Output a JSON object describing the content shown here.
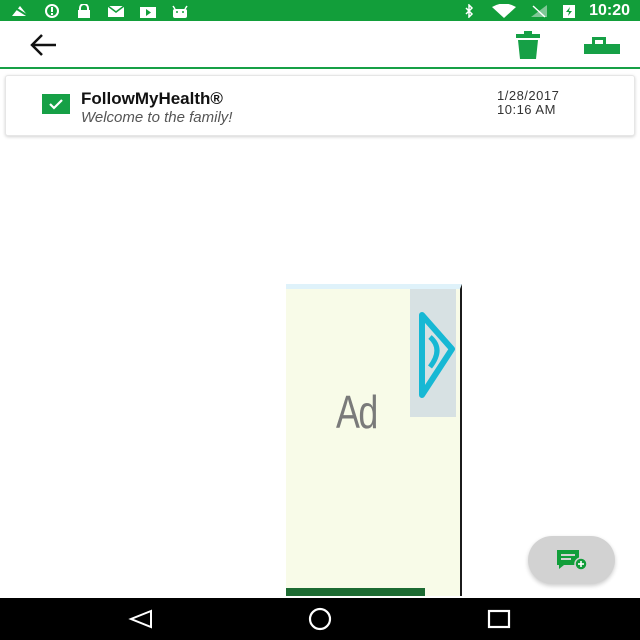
{
  "status_bar": {
    "time": "10:20",
    "left_icons": [
      "signal-off-icon",
      "alert-icon",
      "lock-icon",
      "mail-icon",
      "play-store-icon",
      "android-icon"
    ],
    "right_icons": [
      "bluetooth-icon",
      "wifi-icon",
      "cell-signal-icon",
      "battery-charging-icon"
    ],
    "background_color": "#129e3a"
  },
  "app_bar": {
    "back_icon": "arrow-back-icon",
    "trash_icon": "trash-icon",
    "move_icon": "move-to-folder-icon",
    "accent_color": "#16a046"
  },
  "message": {
    "sender": "FollowMyHealth®",
    "subject": "Welcome to the family!",
    "date": "1/28/2017",
    "time": "10:16 AM",
    "status_icon": "checkbox-checked-icon"
  },
  "ad": {
    "label": "Ad",
    "choice_icon": "ad-choices-icon"
  },
  "fab": {
    "icon": "compose-message-icon"
  },
  "nav_bar": {
    "back_icon": "nav-back-icon",
    "home_icon": "nav-home-icon",
    "recent_icon": "nav-recents-icon"
  }
}
